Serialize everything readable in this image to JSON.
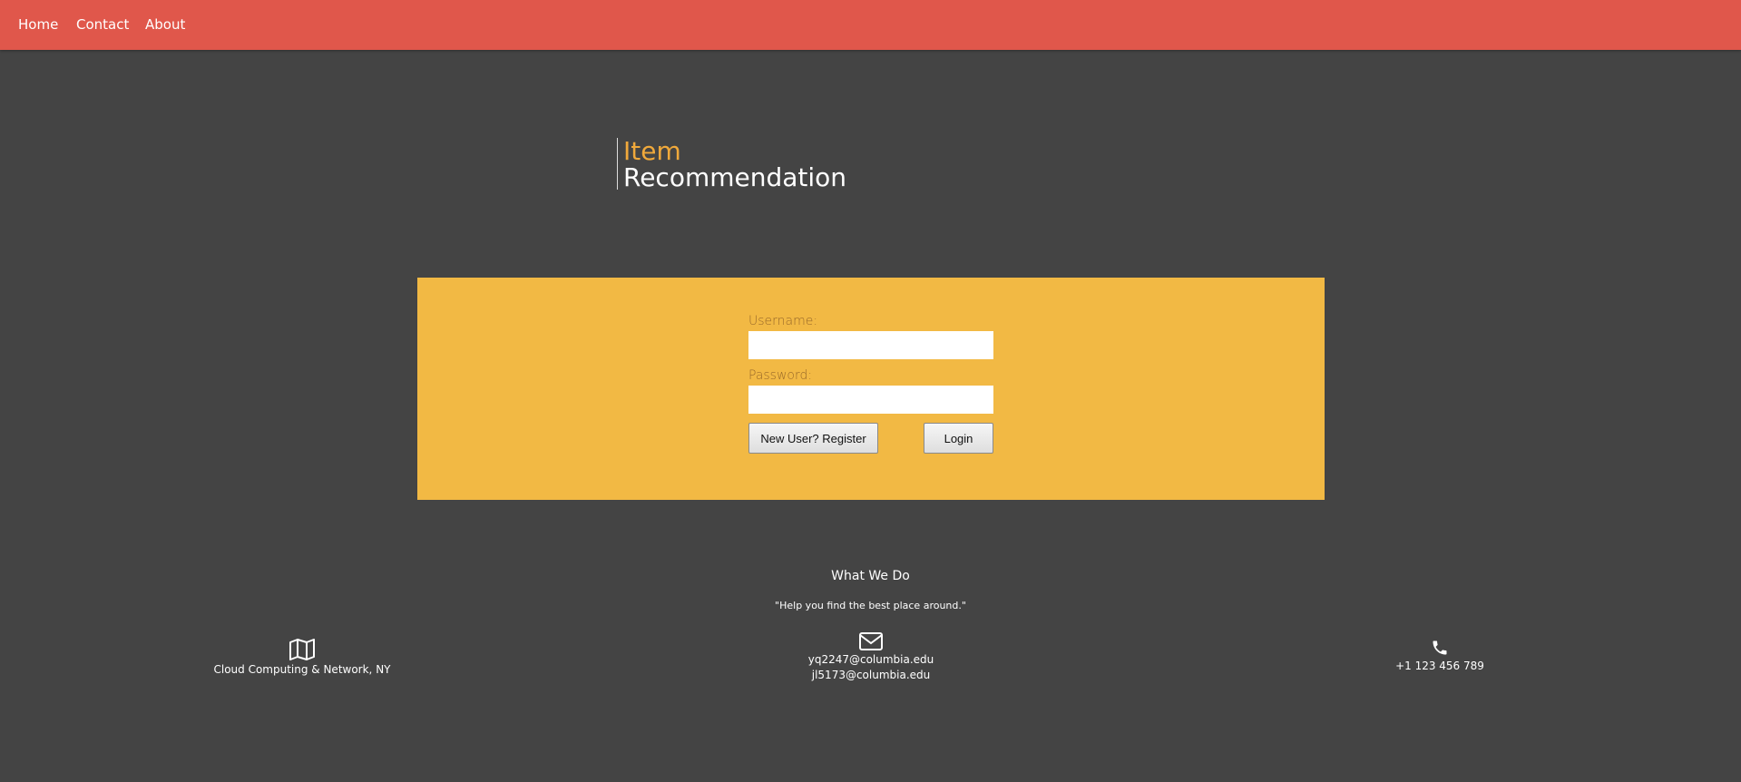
{
  "nav": {
    "home": "Home",
    "contact": "Contact",
    "about": "About"
  },
  "logo": {
    "line1": "Item",
    "line2": "Recommendation"
  },
  "login": {
    "username_label": "Username:",
    "username_value": "",
    "password_label": "Password:",
    "password_value": "",
    "register_button": "New User? Register",
    "login_button": "Login"
  },
  "footer": {
    "heading": "What We Do",
    "tagline": "\"Help you find the best place around.\"",
    "address": "Cloud Computing & Network, NY",
    "emails": [
      "yq2247@columbia.edu",
      "jl5173@columbia.edu"
    ],
    "phone": "+1 123 456 789",
    "icons": {
      "address": "map-icon",
      "email": "envelope-icon",
      "phone": "phone-icon"
    }
  },
  "colors": {
    "navbar": "#e0574b",
    "background": "#444444",
    "panel": "#f2b944",
    "logo_accent": "#f0a93b"
  }
}
